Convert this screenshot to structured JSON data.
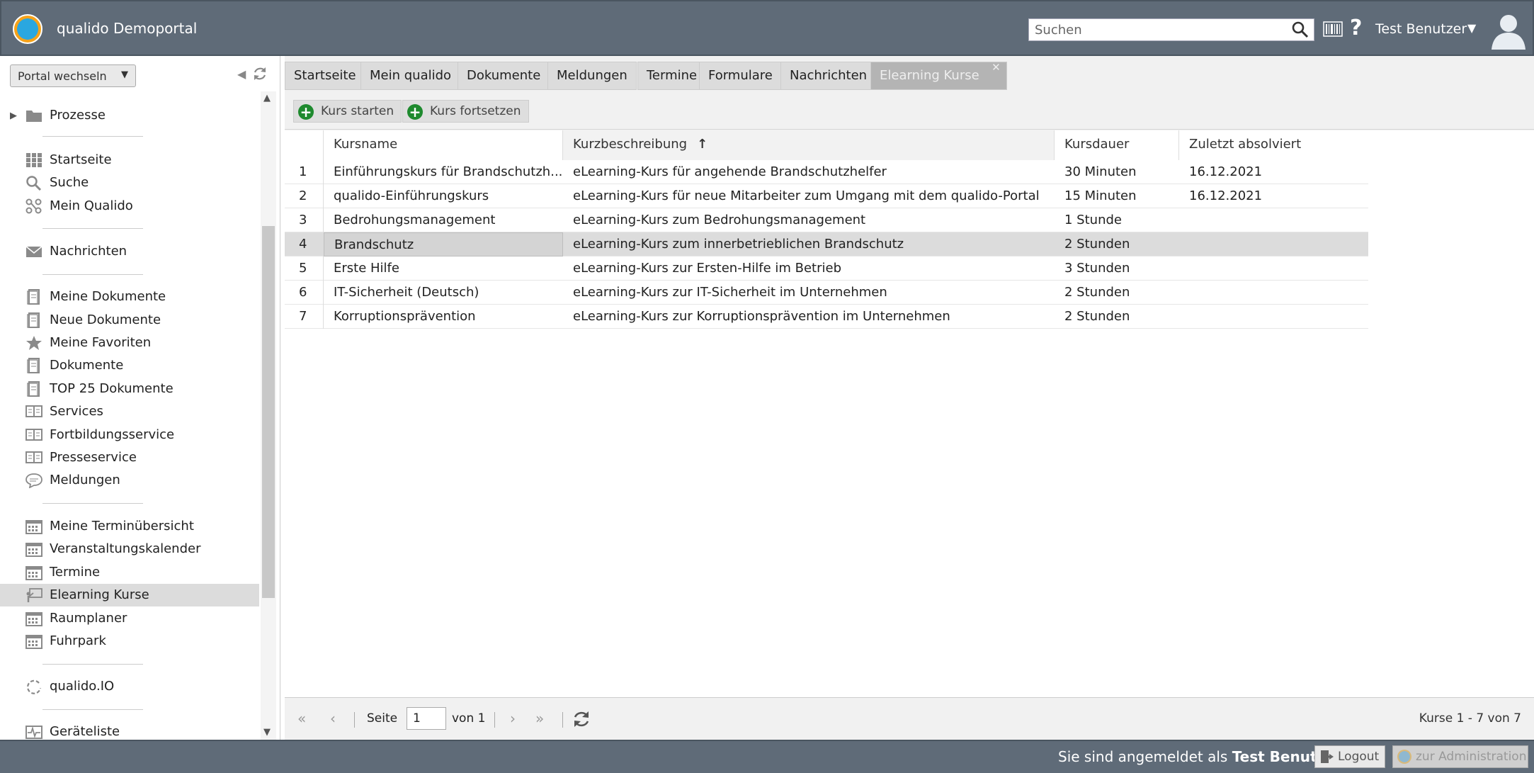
{
  "header": {
    "app_title": "qualido Demoportal",
    "search_placeholder": "Suchen",
    "user_name": "Test Benutzer",
    "help_label": "?",
    "brand_color": "#5f6b78"
  },
  "sidebar": {
    "portal_switch_label": "Portal wechseln",
    "tree_item": "Prozesse",
    "groups": [
      [
        "Startseite",
        "Suche",
        "Mein Qualido"
      ],
      [
        "Nachrichten"
      ],
      [
        "Meine Dokumente",
        "Neue Dokumente",
        "Meine Favoriten",
        "Dokumente",
        "TOP 25 Dokumente",
        "Services",
        "Fortbildungsservice",
        "Presseservice",
        "Meldungen"
      ],
      [
        "Meine Terminübersicht",
        "Veranstaltungskalender",
        "Termine",
        "Elearning Kurse",
        "Raumplaner",
        "Fuhrpark"
      ],
      [
        "qualido.IO"
      ],
      [
        "Geräteliste"
      ]
    ],
    "active_item": "Elearning Kurse"
  },
  "tabs": [
    "Startseite",
    "Mein qualido",
    "Dokumente",
    "Meldungen",
    "Termine",
    "Formulare",
    "Nachrichten",
    "Elearning Kurse"
  ],
  "active_tab": "Elearning Kurse",
  "actions": {
    "start_label": "Kurs starten",
    "continue_label": "Kurs fortsetzen"
  },
  "table": {
    "columns": [
      "Kursname",
      "Kurzbeschreibung",
      "Kursdauer",
      "Zuletzt absolviert"
    ],
    "sort_column": "Kurzbeschreibung",
    "sort_indicator": "↑",
    "rows": [
      {
        "num": "1",
        "name": "Einführungskurs für Brandschutzh...",
        "desc": "eLearning-Kurs für angehende Brandschutzhelfer",
        "duration": "30 Minuten",
        "last": "16.12.2021"
      },
      {
        "num": "2",
        "name": "qualido-Einführungskurs",
        "desc": "eLearning-Kurs für neue Mitarbeiter zum Umgang mit dem qualido-Portal",
        "duration": "15 Minuten",
        "last": "16.12.2021"
      },
      {
        "num": "3",
        "name": "Bedrohungsmanagement",
        "desc": "eLearning-Kurs zum Bedrohungsmanagement",
        "duration": "1 Stunde",
        "last": ""
      },
      {
        "num": "4",
        "name": "Brandschutz",
        "desc": "eLearning-Kurs zum innerbetrieblichen Brandschutz",
        "duration": "2 Stunden",
        "last": ""
      },
      {
        "num": "5",
        "name": "Erste Hilfe",
        "desc": "eLearning-Kurs zur Ersten-Hilfe im Betrieb",
        "duration": "3 Stunden",
        "last": ""
      },
      {
        "num": "6",
        "name": "IT-Sicherheit (Deutsch)",
        "desc": "eLearning-Kurs zur IT-Sicherheit im Unternehmen",
        "duration": "2 Stunden",
        "last": ""
      },
      {
        "num": "7",
        "name": "Korruptionsprävention",
        "desc": "eLearning-Kurs zur Korruptionsprävention im Unternehmen",
        "duration": "2 Stunden",
        "last": ""
      }
    ],
    "selected_row": "4"
  },
  "pager": {
    "page_label": "Seite",
    "page_value": "1",
    "of_label": "von 1",
    "info": "Kurse 1 - 7 von 7"
  },
  "footer": {
    "login_prefix": "Sie sind angemeldet als",
    "login_user": "Test Benutzer",
    "logout_label": "Logout",
    "admin_label": "zur Administration"
  }
}
